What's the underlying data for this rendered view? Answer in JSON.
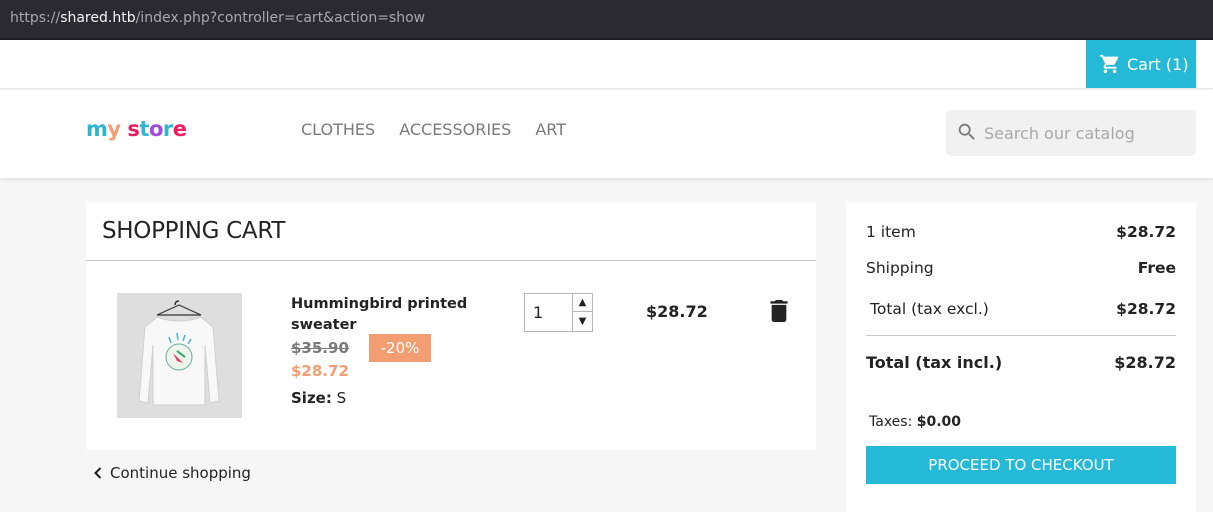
{
  "browser": {
    "url_scheme": "https://",
    "url_host": "shared.htb",
    "url_path": "/index.php?controller=cart&action=show"
  },
  "topnav": {
    "cart_label": "Cart (1)"
  },
  "header": {
    "logo_letters": [
      "m",
      "y",
      " ",
      "s",
      "t",
      "o",
      "r",
      "e"
    ],
    "logo_colors": [
      "#2fb5d2",
      "#f39d72",
      "#ffffff",
      "#ee1c60",
      "#2fb5d2",
      "#9d4bd8",
      "#2fb5d2",
      "#ee1c60"
    ],
    "menu": [
      "CLOTHES",
      "ACCESSORIES",
      "ART"
    ],
    "search_placeholder": "Search our catalog"
  },
  "cart": {
    "title": "SHOPPING CART",
    "item": {
      "name": "Hummingbird printed sweater",
      "old_price": "$35.90",
      "discount": "-20%",
      "price": "$28.72",
      "size_label": "Size:",
      "size_value": "S",
      "quantity": "1",
      "line_total": "$28.72"
    },
    "continue_label": "Continue shopping"
  },
  "summary": {
    "items_label": "1 item",
    "items_value": "$28.72",
    "shipping_label": "Shipping",
    "shipping_value": "Free",
    "total_excl_label": "Total (tax excl.)",
    "total_excl_value": "$28.72",
    "total_incl_label": "Total (tax incl.)",
    "total_incl_value": "$28.72",
    "taxes_label": "Taxes:",
    "taxes_value": "$0.00",
    "checkout_label": "PROCEED TO CHECKOUT"
  },
  "colors": {
    "accent": "#24b9d7",
    "discount": "#f39d72",
    "url_bar": "#2b2a33"
  }
}
